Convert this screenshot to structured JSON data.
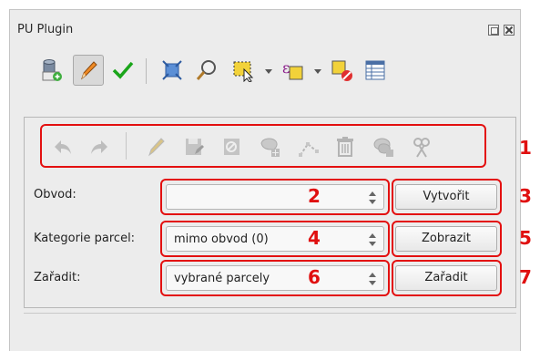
{
  "window": {
    "title": "PU Plugin"
  },
  "toolbar": {
    "icons": [
      "layer-add-icon",
      "edit-pencil-icon",
      "check-icon",
      "zoom-extent-icon",
      "magnifier-icon",
      "select-rectangle-icon",
      "select-expression-icon",
      "deselect-icon",
      "attribute-table-icon"
    ],
    "active_item": "edit-pencil-icon"
  },
  "edit_toolbar": {
    "icons": [
      "undo-icon",
      "redo-icon",
      "edit-pencil-icon",
      "save-edits-icon",
      "cancel-edits-icon",
      "add-feature-icon",
      "edit-vertices-icon",
      "delete-icon",
      "merge-icon",
      "split-icon"
    ],
    "enabled": false
  },
  "form": {
    "obvod_label": "Obvod:",
    "obvod_value": "",
    "obvod_button": "Vytvořit",
    "kategorie_label": "Kategorie parcel:",
    "kategorie_value": "mimo obvod (0)",
    "kategorie_button": "Zobrazit",
    "zaradit_label": "Zařadit:",
    "zaradit_value": "vybrané parcely",
    "zaradit_button": "Zařadit"
  },
  "annotations": {
    "n1": "1",
    "n2": "2",
    "n3": "3",
    "n4": "4",
    "n5": "5",
    "n6": "6",
    "n7": "7",
    "color": "#e01010"
  }
}
